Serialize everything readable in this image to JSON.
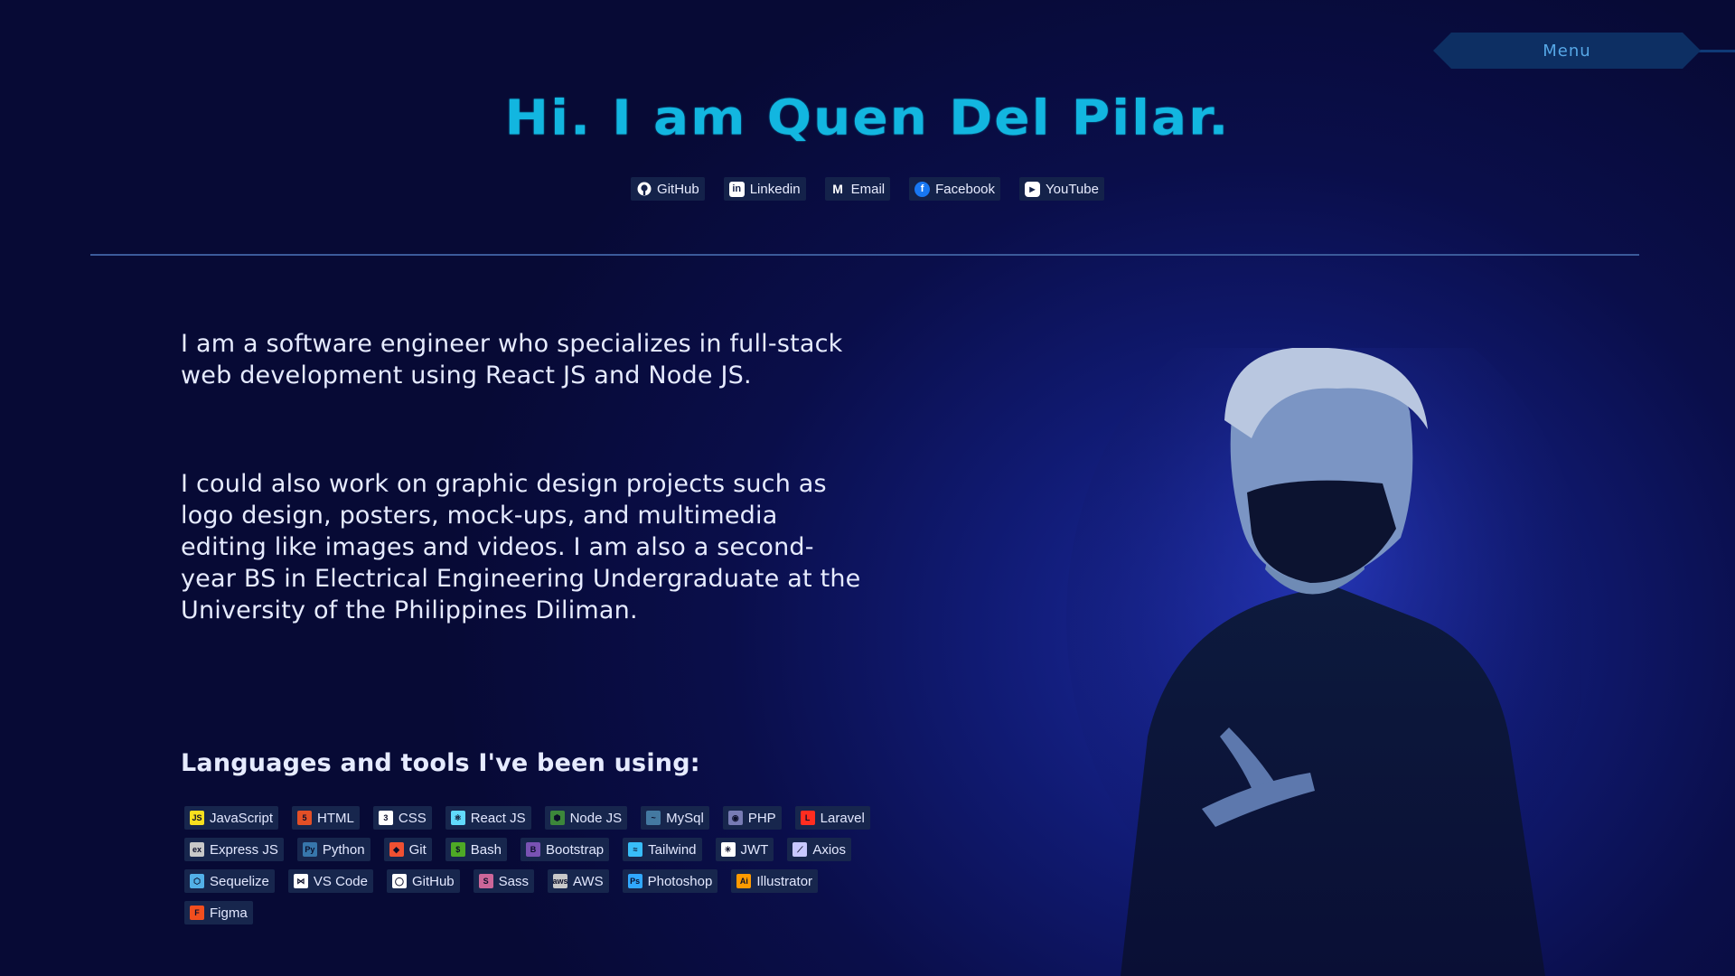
{
  "menu": {
    "label": "Menu"
  },
  "hero": {
    "title": "Hi. I am Quen Del Pilar."
  },
  "socials": [
    {
      "label": "GitHub",
      "icon": "github-icon",
      "color": "#ffffff"
    },
    {
      "label": "Linkedin",
      "icon": "linkedin-icon",
      "color": "#ffffff"
    },
    {
      "label": "Email",
      "icon": "gmail-icon",
      "color": "#ffffff"
    },
    {
      "label": "Facebook",
      "icon": "facebook-icon",
      "color": "#1877f2"
    },
    {
      "label": "YouTube",
      "icon": "youtube-icon",
      "color": "#ffffff"
    }
  ],
  "bio": {
    "paragraph1": "I am a software engineer who specializes in full-stack web development using React JS and Node JS.",
    "paragraph2": "I could also work on graphic design projects such as logo design, posters, mock-ups, and multimedia editing like images and videos. I am also a second-year BS in Electrical Engineering Undergraduate at the University of the Philippines Diliman."
  },
  "tools": {
    "heading": "Languages and tools I've been using:",
    "items": [
      {
        "label": "JavaScript",
        "icon": "javascript-icon",
        "color": "#f7df1e",
        "glyph": "JS"
      },
      {
        "label": "HTML",
        "icon": "html-icon",
        "color": "#e34f26",
        "glyph": "5"
      },
      {
        "label": "CSS",
        "icon": "css-icon",
        "color": "#ffffff",
        "glyph": "3"
      },
      {
        "label": "React JS",
        "icon": "react-icon",
        "color": "#61dafb",
        "glyph": "⚛"
      },
      {
        "label": "Node JS",
        "icon": "nodejs-icon",
        "color": "#3c873a",
        "glyph": "⬢"
      },
      {
        "label": "MySql",
        "icon": "mysql-icon",
        "color": "#4479a1",
        "glyph": "~"
      },
      {
        "label": "PHP",
        "icon": "php-icon",
        "color": "#777bb4",
        "glyph": "◉"
      },
      {
        "label": "Laravel",
        "icon": "laravel-icon",
        "color": "#ff2d20",
        "glyph": "L"
      },
      {
        "label": "Express JS",
        "icon": "express-icon",
        "color": "#c8c8c8",
        "glyph": "ex"
      },
      {
        "label": "Python",
        "icon": "python-icon",
        "color": "#3776ab",
        "glyph": "Py"
      },
      {
        "label": "Git",
        "icon": "git-icon",
        "color": "#f05032",
        "glyph": "◆"
      },
      {
        "label": "Bash",
        "icon": "bash-icon",
        "color": "#4eaa25",
        "glyph": "$"
      },
      {
        "label": "Bootstrap",
        "icon": "bootstrap-icon",
        "color": "#7952b3",
        "glyph": "B"
      },
      {
        "label": "Tailwind",
        "icon": "tailwind-icon",
        "color": "#38bdf8",
        "glyph": "≈"
      },
      {
        "label": "JWT",
        "icon": "jwt-icon",
        "color": "#ffffff",
        "glyph": "✳"
      },
      {
        "label": "Axios",
        "icon": "axios-icon",
        "color": "#c8c8ff",
        "glyph": "⟋"
      },
      {
        "label": "Sequelize",
        "icon": "sequelize-icon",
        "color": "#52b0e7",
        "glyph": "⬡"
      },
      {
        "label": "VS Code",
        "icon": "vscode-icon",
        "color": "#ffffff",
        "glyph": "⋈"
      },
      {
        "label": "GitHub",
        "icon": "github-icon",
        "color": "#ffffff",
        "glyph": "◯"
      },
      {
        "label": "Sass",
        "icon": "sass-icon",
        "color": "#cc6699",
        "glyph": "S"
      },
      {
        "label": "AWS",
        "icon": "aws-icon",
        "color": "#c8c8c8",
        "glyph": "aws"
      },
      {
        "label": "Photoshop",
        "icon": "photoshop-icon",
        "color": "#31a8ff",
        "glyph": "Ps"
      },
      {
        "label": "Illustrator",
        "icon": "illustrator-icon",
        "color": "#ff9a00",
        "glyph": "Ai"
      },
      {
        "label": "Figma",
        "icon": "figma-icon",
        "color": "#f24e1e",
        "glyph": "F"
      }
    ]
  },
  "colors": {
    "accent": "#12b6e0",
    "background": "#0a0e4a",
    "chip": "#17264d"
  }
}
